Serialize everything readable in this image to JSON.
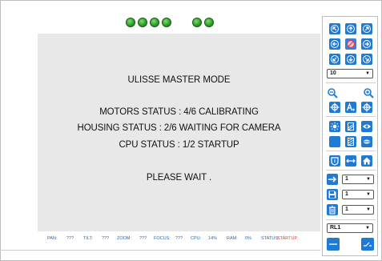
{
  "indicators": [
    {
      "name": "indicator-1",
      "color": "#2ea12a"
    },
    {
      "name": "indicator-2",
      "color": "#2ea12a"
    },
    {
      "name": "indicator-3",
      "color": "#2ea12a"
    },
    {
      "name": "indicator-4",
      "color": "#2ea12a"
    },
    {
      "name": "indicator-5",
      "color": "#2ea12a"
    },
    {
      "name": "indicator-6",
      "color": "#2ea12a"
    }
  ],
  "main": {
    "title": "ULISSE MASTER MODE",
    "motors_status": "MOTORS STATUS :  4/6 CALIBRATING",
    "housing_status": "HOUSING STATUS :  2/6 WAITING FOR CAMERA",
    "cpu_status": "CPU STATUS :  1/2 STARTUP",
    "wait_message": "PLEASE WAIT ."
  },
  "statusbar": {
    "pan_label": "PAN:",
    "pan_value": "???",
    "tilt_label": "TILT:",
    "tilt_value": "???",
    "zoom_label": "ZOOM:",
    "zoom_value": "???",
    "focus_label": "FOCUS:",
    "focus_value": "???",
    "cpu_label": "CPU:",
    "cpu_value": "14%",
    "ram_label": "RAM:",
    "ram_value": "0%",
    "status_label": "STATUS:",
    "status_value": "STARTUP"
  },
  "controls": {
    "speed_select": "10",
    "preset_select_1": "1",
    "preset_select_2": "1",
    "preset_select_3": "1",
    "relay_select": "RL1"
  },
  "colors": {
    "accent": "#1f7ad6",
    "status_text": "#2a66a8",
    "status_alert": "#e53935",
    "panel_bg": "#e8e8e8"
  }
}
